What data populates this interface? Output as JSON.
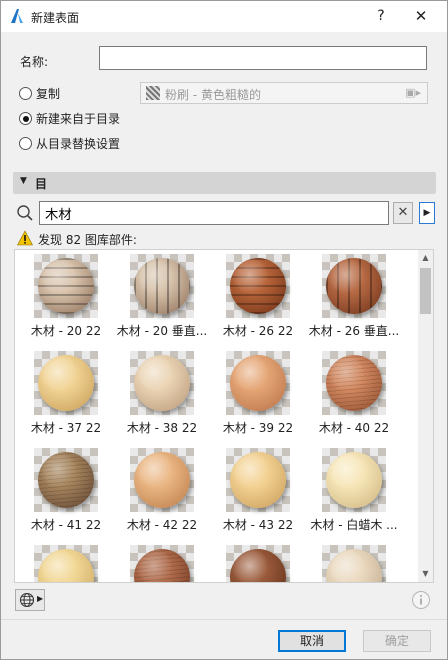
{
  "window": {
    "title": "新建表面",
    "help_label": "?",
    "close_label": "✕"
  },
  "form": {
    "name_label": "名称:",
    "name_value": "",
    "radio_options": [
      {
        "label": "复制",
        "selected": false
      },
      {
        "label": "新建来自于目录",
        "selected": true
      },
      {
        "label": "从目录替换设置",
        "selected": false
      }
    ],
    "copy_source": "粉刷 - 黄色粗糙的"
  },
  "catalog": {
    "section_title": "目",
    "search_value": "木材",
    "clear_label": "✕",
    "expand_label": "▶",
    "found_text": "发现 82 图库部件:",
    "items": [
      {
        "label": "木材 - 20 22",
        "colors": [
          "#d9c4ae",
          "#8a6a52"
        ],
        "pattern": "rings"
      },
      {
        "label": "木材 - 20 垂直...",
        "colors": [
          "#d7c3ac",
          "#8b6b55"
        ],
        "pattern": "staves"
      },
      {
        "label": "木材 - 26 22",
        "colors": [
          "#b8653a",
          "#6a2d14"
        ],
        "pattern": "rings"
      },
      {
        "label": "木材 - 26 垂直...",
        "colors": [
          "#b76a44",
          "#6b3018"
        ],
        "pattern": "staves"
      },
      {
        "label": "木材 - 37 22",
        "colors": [
          "#f1d496",
          "#c69a52"
        ],
        "pattern": "plain"
      },
      {
        "label": "木材 - 38 22",
        "colors": [
          "#ead4b4",
          "#b79676"
        ],
        "pattern": "plain"
      },
      {
        "label": "木材 - 39 22",
        "colors": [
          "#e5a676",
          "#b56f45"
        ],
        "pattern": "plain"
      },
      {
        "label": "木材 - 40 22",
        "colors": [
          "#d48a62",
          "#8c4a2b"
        ],
        "pattern": "grain"
      },
      {
        "label": "木材 - 41 22",
        "colors": [
          "#a8865e",
          "#5e4230"
        ],
        "pattern": "grain"
      },
      {
        "label": "木材 - 42 22",
        "colors": [
          "#eab683",
          "#b87a48"
        ],
        "pattern": "plain"
      },
      {
        "label": "木材 - 43 22",
        "colors": [
          "#f3d293",
          "#c89a56"
        ],
        "pattern": "plain"
      },
      {
        "label": "木材 - 白蜡木 ...",
        "colors": [
          "#f6e6b8",
          "#cdb27c"
        ],
        "pattern": "plain"
      },
      {
        "label": "",
        "colors": [
          "#f2d896",
          "#c8a25e"
        ],
        "pattern": "plain"
      },
      {
        "label": "",
        "colors": [
          "#b26d4c",
          "#6b341e"
        ],
        "pattern": "grain"
      },
      {
        "label": "",
        "colors": [
          "#9a5a3a",
          "#5a2c18"
        ],
        "pattern": "plain"
      },
      {
        "label": "",
        "colors": [
          "#ead9bf",
          "#bca488"
        ],
        "pattern": "plain"
      }
    ]
  },
  "footer": {
    "cancel_label": "取消",
    "ok_label": "确定"
  },
  "colors": {
    "accent": "#0078d7",
    "warning": "#f2c300"
  }
}
